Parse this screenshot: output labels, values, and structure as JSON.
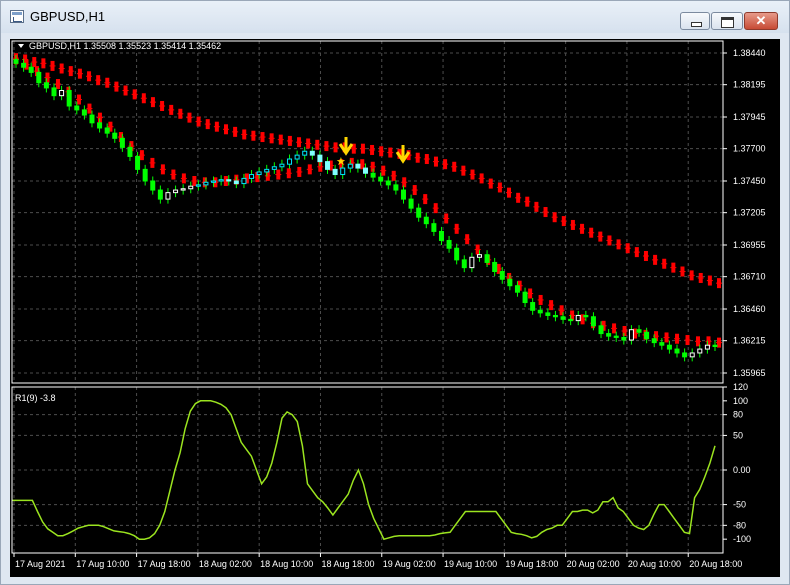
{
  "window": {
    "title": "GBPUSD,H1",
    "close_glyph": "✕"
  },
  "main_chart": {
    "info_line": "GBPUSD,H1  1.35508 1.35523 1.35414 1.35462",
    "price_labels": [
      "1.38440",
      "1.38195",
      "1.37945",
      "1.37700",
      "1.37450",
      "1.37205",
      "1.36955",
      "1.36710",
      "1.36460",
      "1.36215",
      "1.35965"
    ]
  },
  "indicator": {
    "label": "R1(9) -3.8",
    "scale_labels": [
      "120",
      "100",
      "80",
      "50",
      "0.00",
      "-50",
      "-80",
      "-100"
    ]
  },
  "time_axis": {
    "labels": [
      "17 Aug 2021",
      "17 Aug 10:00",
      "17 Aug 18:00",
      "18 Aug 02:00",
      "18 Aug 10:00",
      "18 Aug 18:00",
      "19 Aug 02:00",
      "19 Aug 10:00",
      "19 Aug 18:00",
      "20 Aug 02:00",
      "20 Aug 10:00",
      "20 Aug 18:00"
    ]
  },
  "chart_data": [
    {
      "type": "candlestick",
      "title": "GBPUSD,H1",
      "ylim": [
        1.35965,
        1.3844
      ],
      "close_series_approx": [
        1.3836,
        1.3833,
        1.3829,
        1.3821,
        1.3817,
        1.3811,
        1.3815,
        1.3803,
        1.38,
        1.3796,
        1.379,
        1.3786,
        1.3782,
        1.3778,
        1.3771,
        1.3764,
        1.3754,
        1.3745,
        1.3738,
        1.3731,
        1.3736,
        1.3738,
        1.3739,
        1.3741,
        1.3742,
        1.3744,
        1.3745,
        1.3746,
        1.3745,
        1.3743,
        1.3747,
        1.375,
        1.3752,
        1.3754,
        1.3756,
        1.3758,
        1.3762,
        1.3765,
        1.3768,
        1.3765,
        1.376,
        1.3754,
        1.375,
        1.3755,
        1.3758,
        1.3755,
        1.3751,
        1.3748,
        1.3745,
        1.3742,
        1.3738,
        1.3731,
        1.3724,
        1.3717,
        1.3712,
        1.3706,
        1.3699,
        1.3693,
        1.3684,
        1.3678,
        1.3686,
        1.3688,
        1.3682,
        1.3675,
        1.3669,
        1.3664,
        1.3659,
        1.3651,
        1.3645,
        1.3643,
        1.3641,
        1.364,
        1.3638,
        1.3637,
        1.3641,
        1.364,
        1.3633,
        1.3627,
        1.3625,
        1.3624,
        1.3622,
        1.363,
        1.3628,
        1.3623,
        1.362,
        1.3618,
        1.3615,
        1.3612,
        1.3609,
        1.3612,
        1.3615,
        1.3618,
        1.3617
      ],
      "upper_band": [
        1.384,
        1.3839,
        1.3837,
        1.3836,
        1.3834,
        1.3832,
        1.383,
        1.3828,
        1.3826,
        1.3823,
        1.3821,
        1.3818,
        1.3815,
        1.3812,
        1.3809,
        1.3806,
        1.3803,
        1.38,
        1.3797,
        1.3794,
        1.3791,
        1.3789,
        1.3787,
        1.3785,
        1.3783,
        1.3781,
        1.378,
        1.3779,
        1.3778,
        1.3777,
        1.3776,
        1.3775,
        1.3774,
        1.3773,
        1.3772,
        1.3771,
        1.3771,
        1.377,
        1.377,
        1.3769,
        1.3768,
        1.3767,
        1.3766,
        1.3765,
        1.3763,
        1.3762,
        1.376,
        1.3758,
        1.3756,
        1.3753,
        1.375,
        1.3747,
        1.3743,
        1.374,
        1.3736,
        1.3732,
        1.3729,
        1.3725,
        1.3721,
        1.3717,
        1.3714,
        1.3711,
        1.3708,
        1.3705,
        1.3702,
        1.3699,
        1.3696,
        1.3693,
        1.369,
        1.3687,
        1.3684,
        1.3681,
        1.3678,
        1.3675,
        1.3672,
        1.367,
        1.3668,
        1.3666
      ],
      "lower_band": [
        1.3839,
        1.3835,
        1.383,
        1.3825,
        1.382,
        1.3814,
        1.3808,
        1.3801,
        1.3794,
        1.3787,
        1.3779,
        1.3772,
        1.3765,
        1.3759,
        1.3754,
        1.375,
        1.3747,
        1.3745,
        1.3744,
        1.3744,
        1.3745,
        1.3746,
        1.3747,
        1.3748,
        1.3749,
        1.375,
        1.3751,
        1.3752,
        1.3754,
        1.3756,
        1.3757,
        1.3758,
        1.3759,
        1.3758,
        1.3756,
        1.3753,
        1.3749,
        1.3744,
        1.3738,
        1.3731,
        1.3724,
        1.3716,
        1.3708,
        1.37,
        1.3692,
        1.3684,
        1.3677,
        1.367,
        1.3664,
        1.3658,
        1.3653,
        1.3649,
        1.3645,
        1.3641,
        1.3638,
        1.3635,
        1.3633,
        1.3631,
        1.3629,
        1.3627,
        1.3626,
        1.3625,
        1.3624,
        1.3623,
        1.3622,
        1.3621,
        1.3621,
        1.362
      ]
    },
    {
      "type": "line",
      "title": "R1(9) -3.8",
      "ylim": [
        -120,
        120
      ],
      "values": [
        -44,
        -44,
        -44,
        -44,
        -44,
        -60,
        -75,
        -85,
        -90,
        -95,
        -95,
        -92,
        -88,
        -84,
        -82,
        -80,
        -80,
        -80,
        -82,
        -85,
        -88,
        -89,
        -90,
        -92,
        -95,
        -100,
        -100,
        -98,
        -92,
        -80,
        -60,
        -30,
        0,
        25,
        60,
        85,
        96,
        100,
        100,
        100,
        98,
        95,
        90,
        80,
        60,
        40,
        30,
        20,
        0,
        -20,
        -10,
        10,
        40,
        75,
        84,
        80,
        70,
        35,
        -20,
        -30,
        -40,
        -46,
        -55,
        -65,
        -55,
        -45,
        -35,
        -15,
        0,
        -20,
        -50,
        -70,
        -85,
        -100,
        -98,
        -96,
        -95,
        -95,
        -95,
        -95,
        -95,
        -95,
        -95,
        -94,
        -92,
        -91,
        -90,
        -80,
        -70,
        -60,
        -60,
        -60,
        -60,
        -60,
        -60,
        -60,
        -70,
        -80,
        -90,
        -92,
        -93,
        -95,
        -98,
        -96,
        -90,
        -86,
        -84,
        -80,
        -80,
        -70,
        -60,
        -60,
        -58,
        -58,
        -62,
        -58,
        -46,
        -46,
        -40,
        -55,
        -60,
        -70,
        -80,
        -84,
        -86,
        -80,
        -64,
        -50,
        -50,
        -60,
        -70,
        -80,
        -90,
        -92,
        -40,
        -28,
        -10,
        10,
        35
      ]
    }
  ]
}
